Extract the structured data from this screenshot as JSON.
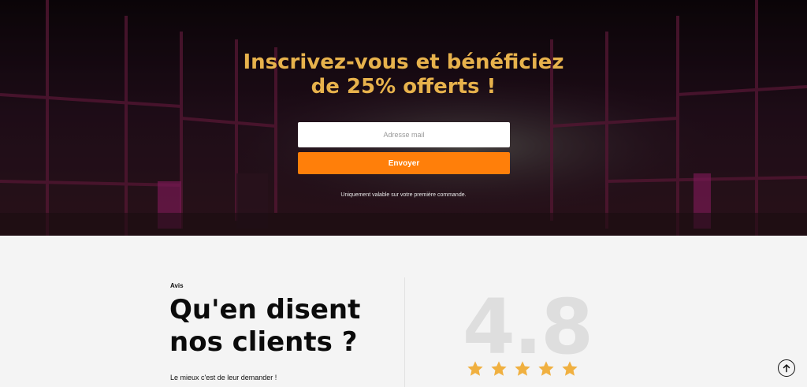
{
  "hero": {
    "title_line1": "Inscrivez-vous et bénéficiez",
    "title_line2": "de 25% offerts !",
    "email_placeholder": "Adresse mail",
    "email_value": "",
    "submit_label": "Envoyer",
    "note": "Uniquement valable sur votre première commande."
  },
  "reviews": {
    "kicker": "Avis",
    "heading_line1": "Qu'en disent",
    "heading_line2": "nos clients ?",
    "subtext": "Le mieux c'est de leur demander !",
    "score": "4.8",
    "stars": 5
  },
  "icons": {
    "star": "star-icon",
    "back_to_top": "arrow-up-icon"
  },
  "colors": {
    "title_gold": "#e7b24c",
    "button_orange": "#ff7f0a",
    "star_gold": "#f0b040",
    "score_gray": "#dedede"
  }
}
